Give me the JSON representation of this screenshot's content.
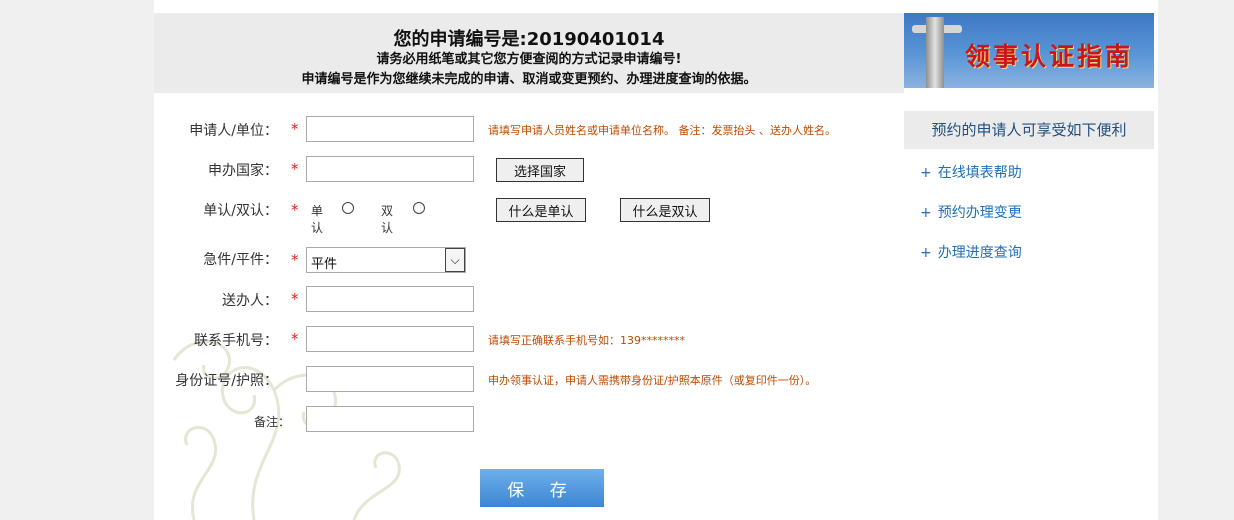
{
  "banner": {
    "line1": "您的申请编号是:20190401014",
    "line2": "请务必用纸笔或其它您方便查阅的方式记录申请编号!",
    "line3": "申请编号是作为您继续未完成的申请、取消或变更预约、办理进度查询的依据。"
  },
  "logo": {
    "text": "领事认证指南"
  },
  "form": {
    "applicant": {
      "label": "申请人/单位：",
      "hint": "请填写申请人员姓名或申请单位名称。 备注：发票抬头 、送办人姓名。",
      "value": ""
    },
    "country": {
      "label": "申办国家：",
      "value": "",
      "button": "选择国家"
    },
    "cert_type": {
      "label": "单认/双认：",
      "option_single": "单认",
      "option_double": "双认",
      "btn_single": "什么是单认",
      "btn_double": "什么是双认"
    },
    "urgency": {
      "label": "急件/平件：",
      "selected": "平件",
      "arrow": "⌵"
    },
    "sender": {
      "label": "送办人：",
      "value": ""
    },
    "phone": {
      "label": "联系手机号：",
      "hint": "请填写正确联系手机号如：139********",
      "value": ""
    },
    "id_number": {
      "label": "身份证号/护照：",
      "hint": "申办领事认证，申请人需携带身份证/护照本原件（或复印件一份）。",
      "value": ""
    },
    "remark": {
      "label": "备注：",
      "value": ""
    },
    "required_mark": "*",
    "save_label": "保 存"
  },
  "sidebar": {
    "title": "预约的申请人可享受如下便利",
    "links": [
      {
        "label": "在线填表帮助"
      },
      {
        "label": "预约办理变更"
      },
      {
        "label": "办理进度查询"
      }
    ],
    "plus": "+"
  },
  "colors": {
    "accent": "#3d86d4",
    "hint": "#c04a00",
    "required": "#e02020",
    "link": "#1f6fb8"
  }
}
